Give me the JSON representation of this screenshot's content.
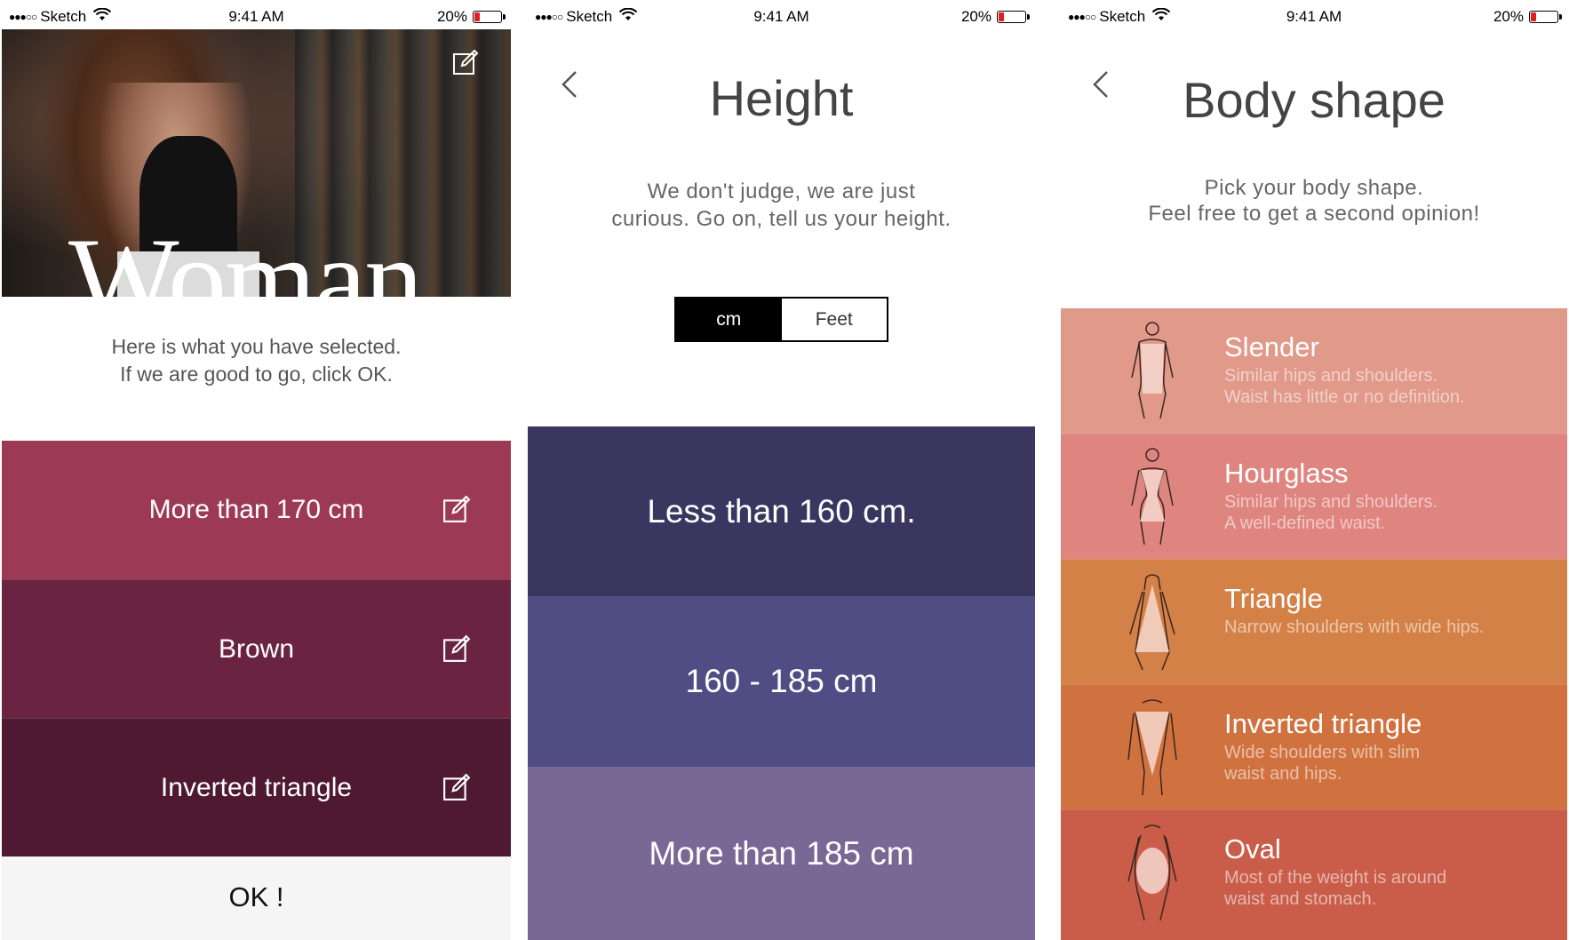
{
  "status": {
    "carrier": "Sketch",
    "time": "9:41 AM",
    "battery": "20%",
    "battery_level": 0.2
  },
  "summary": {
    "hero_title": "Woman",
    "subtitle_line1": "Here is what you have selected.",
    "subtitle_line2": "If we are good to go, click OK.",
    "selections": [
      {
        "label": "More than 170 cm",
        "color": "#9c3a56"
      },
      {
        "label": "Brown",
        "color": "#6a2340"
      },
      {
        "label": "Inverted triangle",
        "color": "#4f1a31"
      }
    ],
    "ok_label": "OK !"
  },
  "height": {
    "title": "Height",
    "desc_line1": "We don't judge, we are just",
    "desc_line2": "curious. Go on, tell us your height.",
    "unit_options": [
      "cm",
      "Feet"
    ],
    "selected_unit": "cm",
    "options": [
      {
        "label": "Less than 160 cm.",
        "color": "#3b365f"
      },
      {
        "label": "160 - 185 cm",
        "color": "#4f4d83"
      },
      {
        "label": "More than 185 cm",
        "color": "#796795"
      }
    ]
  },
  "body_shape": {
    "title": "Body shape",
    "desc_line1": "Pick your body shape.",
    "desc_line2": "Feel free to get a second opinion!",
    "options": [
      {
        "name": "Slender",
        "line1": "Similar hips and shoulders.",
        "line2": "Waist has little or no definition.",
        "color": "#e1998a"
      },
      {
        "name": "Hourglass",
        "line1": "Similar hips and shoulders.",
        "line2": "A well-defined waist.",
        "color": "#df8580"
      },
      {
        "name": "Triangle",
        "line1": "Narrow shoulders with wide hips.",
        "line2": "",
        "color": "#d48147"
      },
      {
        "name": "Inverted triangle",
        "line1": "Wide shoulders with slim",
        "line2": "waist and hips.",
        "color": "#d0723f"
      },
      {
        "name": "Oval",
        "line1": "Most of the weight is around",
        "line2": "waist and stomach.",
        "color": "#c95d4a"
      }
    ]
  }
}
